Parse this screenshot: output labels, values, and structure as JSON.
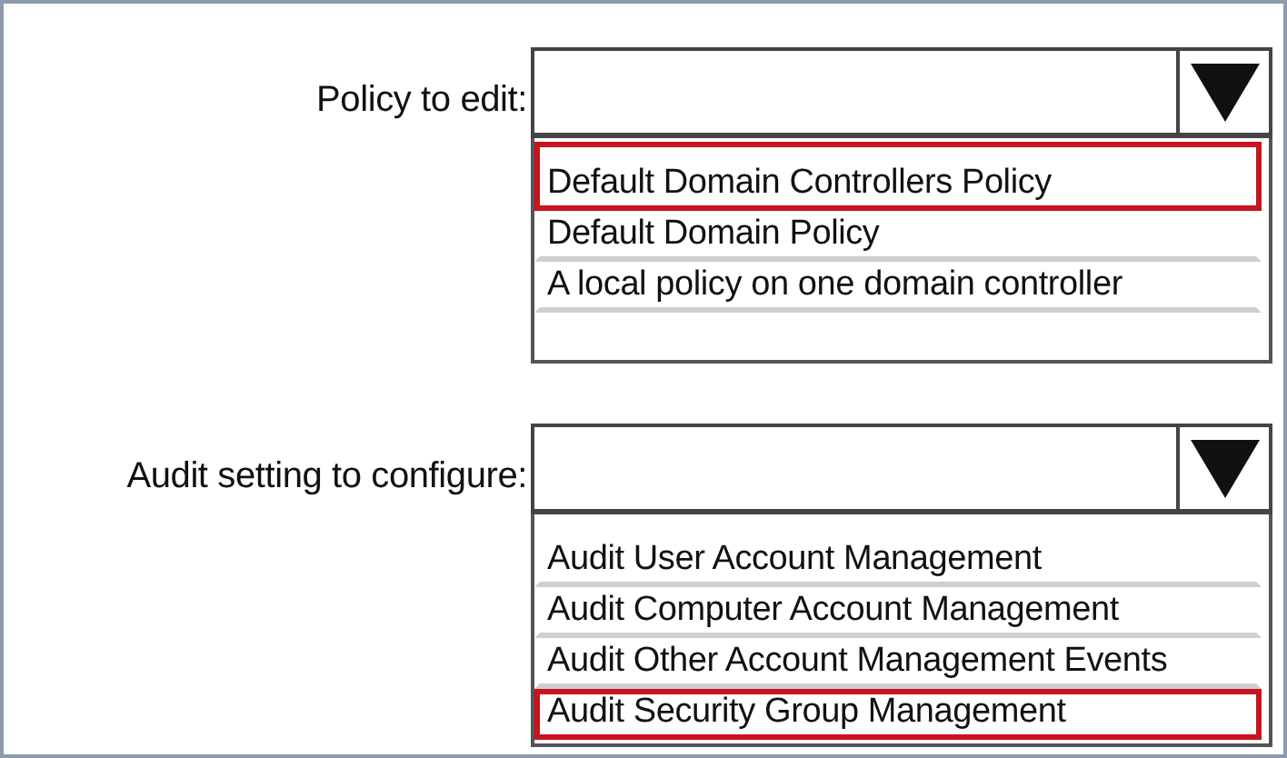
{
  "fields": [
    {
      "label": "Policy to edit:",
      "options": [
        {
          "label": "Default Domain Controllers Policy",
          "selected": true
        },
        {
          "label": "Default Domain Policy",
          "selected": false
        },
        {
          "label": "A local policy on one domain controller",
          "selected": false
        }
      ]
    },
    {
      "label": "Audit setting to configure:",
      "options": [
        {
          "label": "Audit User Account Management",
          "selected": false
        },
        {
          "label": "Audit Computer Account Management",
          "selected": false
        },
        {
          "label": "Audit Other Account Management Events",
          "selected": false
        },
        {
          "label": "Audit Security Group Management",
          "selected": true
        }
      ]
    }
  ]
}
